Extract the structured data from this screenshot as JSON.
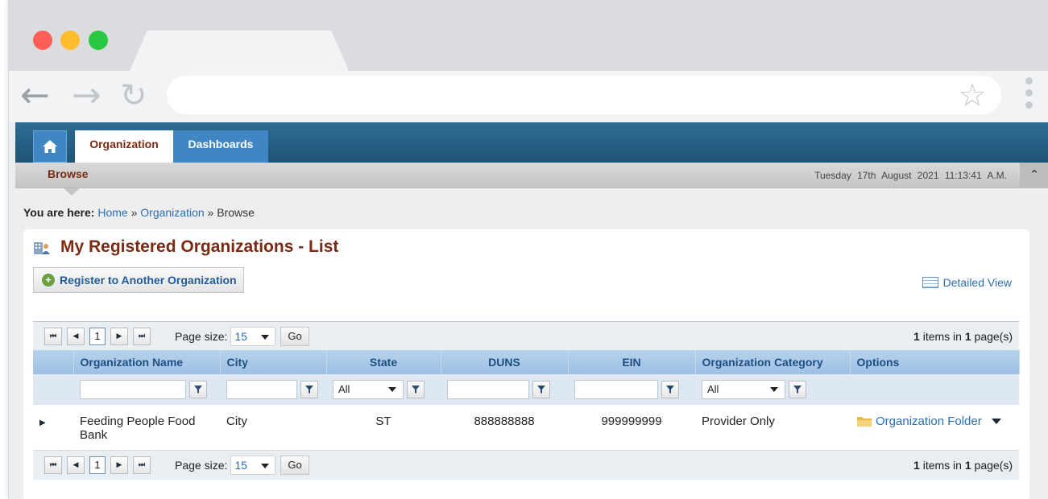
{
  "app": {
    "nav_tabs": [
      {
        "label": "Organization",
        "active": true
      },
      {
        "label": "Dashboards",
        "active": false
      }
    ],
    "subnav_label": "Browse",
    "datetime": "Tuesday 17th August 2021 11:13:41 A.M."
  },
  "breadcrumb": {
    "prefix": "You are here:",
    "items": [
      "Home",
      "Organization",
      "Browse"
    ],
    "separator": "»"
  },
  "panel": {
    "title": "My Registered Organizations - List",
    "register_button": "Register to Another Organization",
    "detailed_view": "Detailed View"
  },
  "pager": {
    "current_page": "1",
    "page_size_label": "Page size:",
    "page_size": "15",
    "go_label": "Go",
    "items_count": "1",
    "items_text_1": "items in",
    "pages_count": "1",
    "items_text_2": "page(s)"
  },
  "table": {
    "columns": [
      "Organization Name",
      "City",
      "State",
      "DUNS",
      "EIN",
      "Organization Category",
      "Options"
    ],
    "filters": {
      "state": "All",
      "category": "All"
    },
    "rows": [
      {
        "name": "Feeding People Food Bank",
        "city": "City",
        "state": "ST",
        "duns": "888888888",
        "ein": "999999999",
        "category": "Provider Only",
        "option": "Organization Folder"
      }
    ]
  },
  "colors": {
    "brand_dark": "#1f5375",
    "tab_blue": "#3f86c2",
    "title_maroon": "#7b2a14",
    "link_blue": "#2a6fb5",
    "header_blue": "#9dc0e4"
  }
}
